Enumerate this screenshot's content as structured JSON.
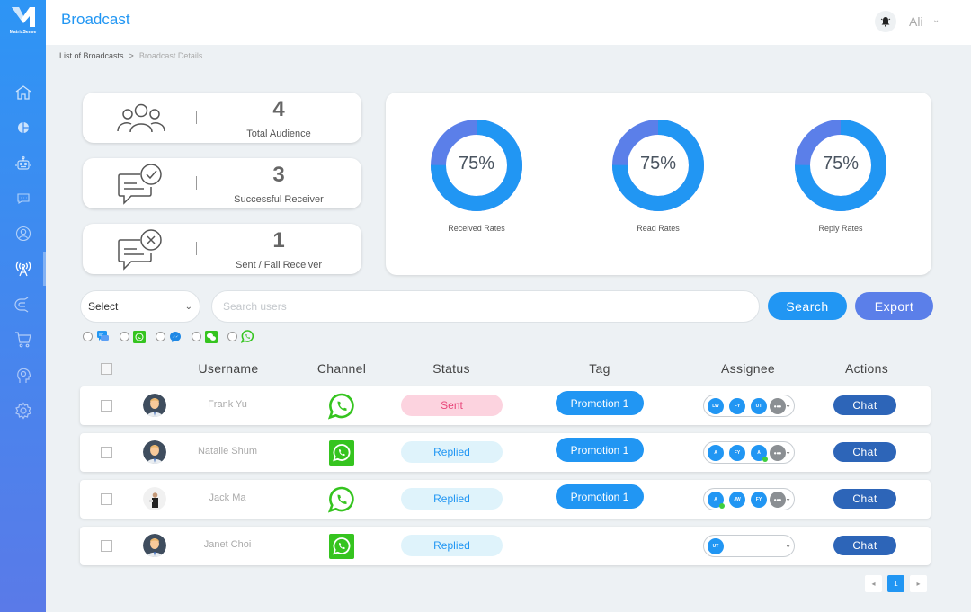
{
  "app": {
    "brand": "MatrixSense",
    "title": "Broadcast"
  },
  "user": {
    "name": "Ali",
    "bell_icon": "bell-icon",
    "chevron_icon": "chevron-down-icon"
  },
  "breadcrumb": {
    "items": [
      "List of Broadcasts",
      "Broadcast Details"
    ],
    "separator": ">"
  },
  "sidebar": {
    "items": [
      {
        "name": "home",
        "icon": "home-icon"
      },
      {
        "name": "analytics",
        "icon": "pie-chart-icon"
      },
      {
        "name": "bot",
        "icon": "robot-icon"
      },
      {
        "name": "chat",
        "icon": "chat-bubble-icon"
      },
      {
        "name": "contacts",
        "icon": "user-circle-icon"
      },
      {
        "name": "broadcast",
        "icon": "broadcast-tower-icon",
        "active": true
      },
      {
        "name": "marketing",
        "icon": "magnet-icon"
      },
      {
        "name": "shop",
        "icon": "cart-icon"
      },
      {
        "name": "ai",
        "icon": "brain-head-icon"
      },
      {
        "name": "settings",
        "icon": "gear-icon"
      }
    ]
  },
  "stats": [
    {
      "value": "4",
      "label": "Total Audience",
      "icon": "users-group-icon"
    },
    {
      "value": "3",
      "label": "Successful Receiver",
      "icon": "message-check-icon"
    },
    {
      "value": "1",
      "label": "Sent / Fail Receiver",
      "icon": "message-x-icon"
    }
  ],
  "rates": [
    {
      "label": "Received Rates",
      "percent": 75,
      "display": "75%"
    },
    {
      "label": "Read Rates",
      "percent": 75,
      "display": "75%"
    },
    {
      "label": "Reply Rates",
      "percent": 75,
      "display": "75%"
    }
  ],
  "colors": {
    "primary": "#2196f3",
    "secondary": "#5b7fe9",
    "chat_button": "#2d65b8",
    "sent_bg": "#fcd3df",
    "sent_text": "#e8467a",
    "replied_bg": "#dff3fb",
    "online": "#3fce3f"
  },
  "toolbar": {
    "select_value": "Select",
    "search_placeholder": "Search users",
    "search_label": "Search",
    "export_label": "Export"
  },
  "channel_filters": [
    {
      "name": "livechat",
      "icon": "livechat-icon"
    },
    {
      "name": "whatsapp-business",
      "icon": "whatsapp-square-icon"
    },
    {
      "name": "messenger",
      "icon": "messenger-icon"
    },
    {
      "name": "wechat",
      "icon": "wechat-icon"
    },
    {
      "name": "whatsapp",
      "icon": "whatsapp-icon"
    }
  ],
  "table": {
    "headers": [
      "Username",
      "Channel",
      "Status",
      "Tag",
      "Assignee",
      "Actions"
    ],
    "rows": [
      {
        "username": "Frank Yu",
        "channel": "whatsapp",
        "status": "Sent",
        "status_type": "sent",
        "tag": "Promotion 1",
        "assignees": [
          {
            "initials": "LW"
          },
          {
            "initials": "FY"
          },
          {
            "initials": "UT"
          }
        ],
        "more": true,
        "action": "Chat"
      },
      {
        "username": "Natalie Shum",
        "channel": "whatsapp-business",
        "status": "Replied",
        "status_type": "replied",
        "tag": "Promotion 1",
        "assignees": [
          {
            "initials": "A"
          },
          {
            "initials": "FY"
          },
          {
            "initials": "A",
            "online": true
          }
        ],
        "more": true,
        "action": "Chat"
      },
      {
        "username": "Jack Ma",
        "channel": "whatsapp",
        "status": "Replied",
        "status_type": "replied",
        "tag": "Promotion 1",
        "assignees": [
          {
            "initials": "A",
            "online": true
          },
          {
            "initials": "JW"
          },
          {
            "initials": "FY"
          }
        ],
        "more": true,
        "action": "Chat"
      },
      {
        "username": "Janet Choi",
        "channel": "whatsapp-business",
        "status": "Replied",
        "status_type": "replied",
        "tag": "",
        "assignees": [
          {
            "initials": "UT"
          }
        ],
        "more": false,
        "action": "Chat"
      }
    ]
  },
  "pagination": {
    "prev": "◂",
    "current": "1",
    "next": "▸"
  }
}
